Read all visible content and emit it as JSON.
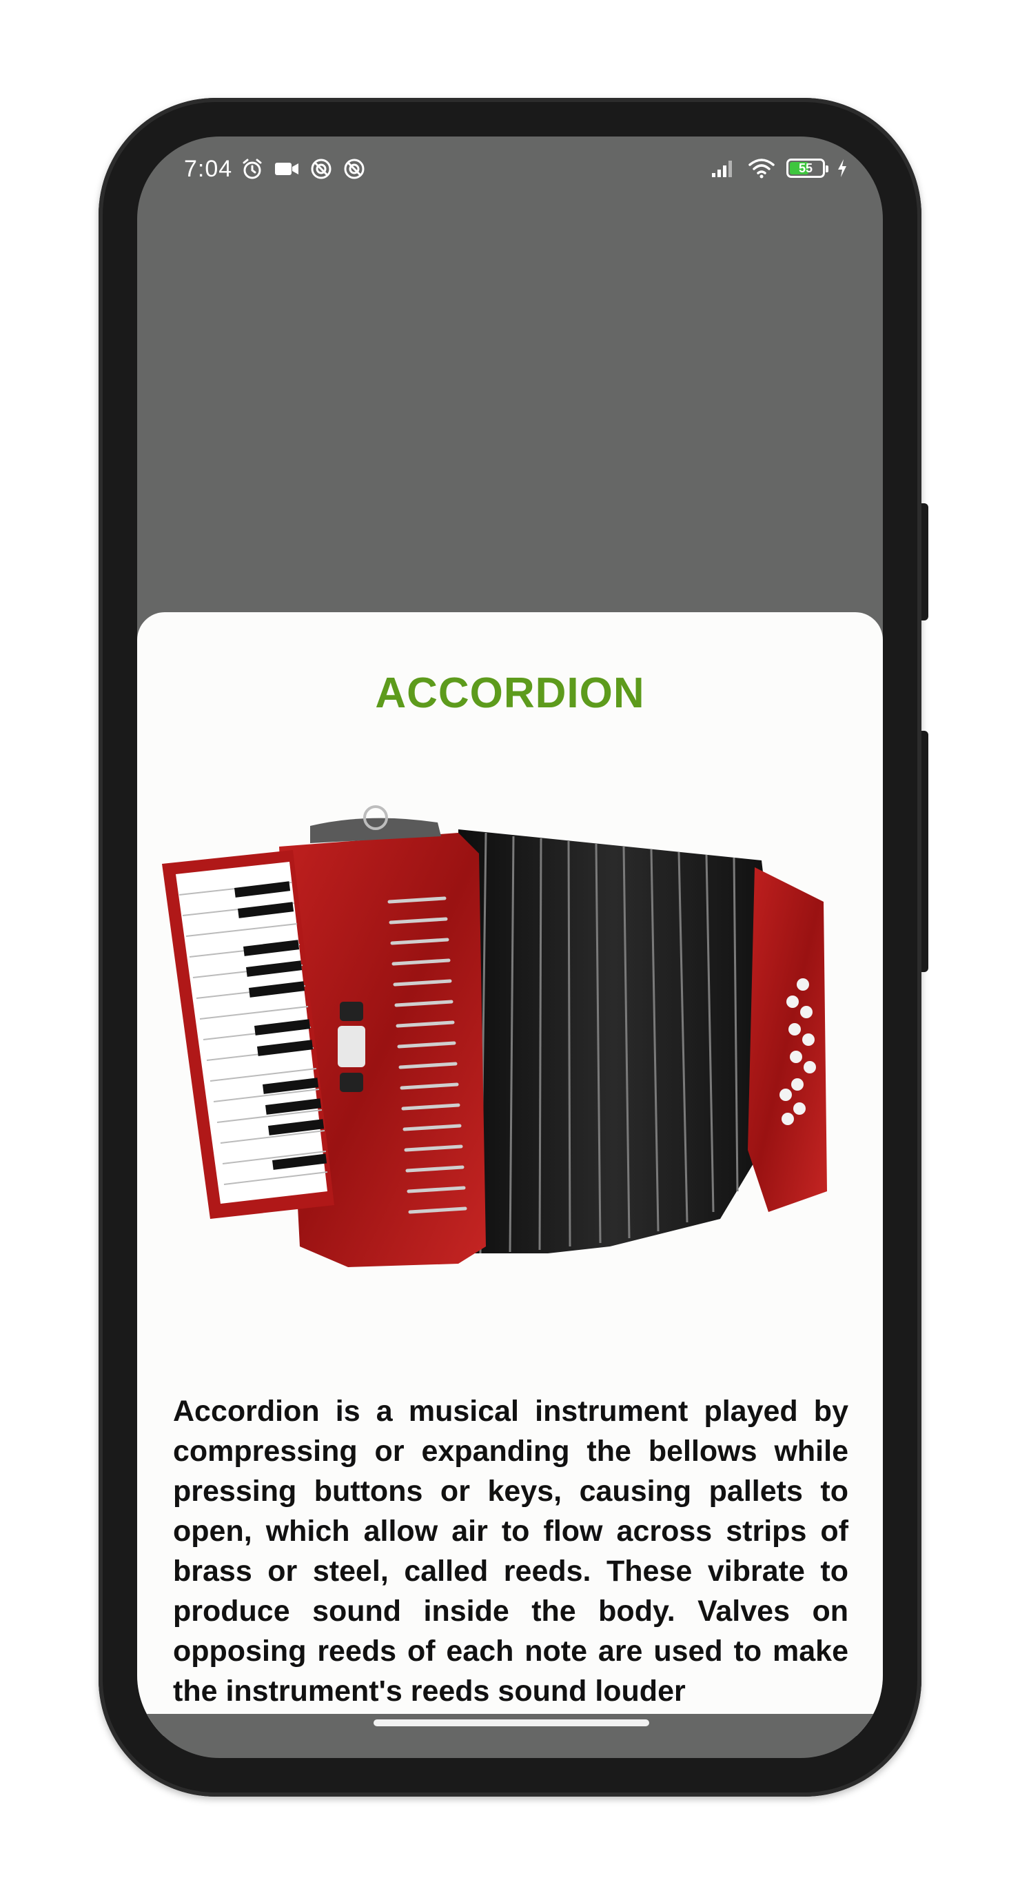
{
  "status_bar": {
    "time": "7:04",
    "battery_level": "55",
    "left_icons": [
      "alarm-icon",
      "video-camera-icon",
      "do-not-disturb-icon",
      "do-not-disturb-icon"
    ],
    "right_icons": [
      "signal-icon",
      "wifi-icon",
      "battery-icon",
      "charging-icon"
    ]
  },
  "colors": {
    "title": "#5d9b1c",
    "top_area": "#666766",
    "sheet": "#fcfcfb",
    "battery_fill": "#3ec63e"
  },
  "detail": {
    "title": "ACCORDION",
    "image_icon": "accordion-image",
    "description": "Accordion is a musical instrument played by compressing or expanding the bellows while pressing buttons or keys, causing pallets to open, which allow air to flow across strips of brass or steel, called reeds. These vibrate to produce sound inside the body. Valves on opposing reeds of each note are used to make the instrument's reeds sound louder"
  }
}
